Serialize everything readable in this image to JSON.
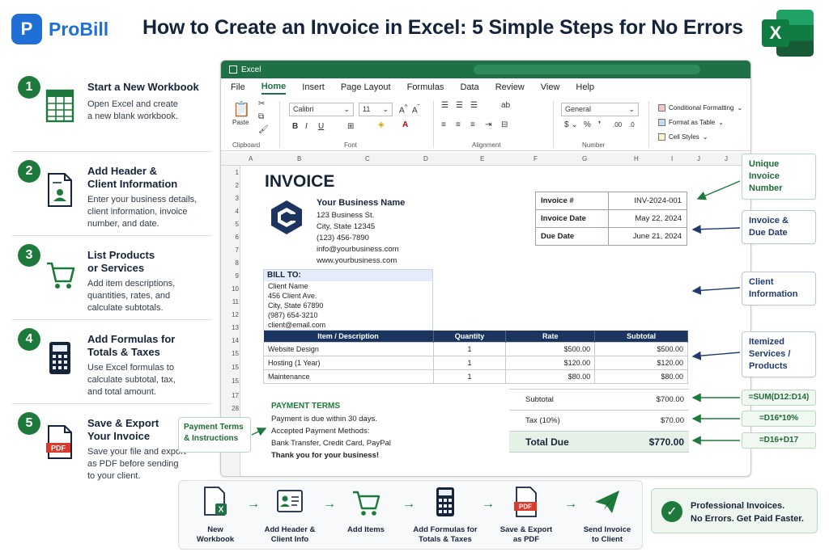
{
  "brand": {
    "logo_letter": "P",
    "name": "ProBill"
  },
  "title": "How to Create an Invoice in Excel: 5 Simple Steps for No Errors",
  "excel_logo_letter": "X",
  "steps": [
    {
      "num": "1",
      "title_lines": [
        "Start a New Workbook"
      ],
      "desc_lines": [
        "Open Excel and create",
        "a new blank workbook."
      ],
      "icon": "spreadsheet-icon"
    },
    {
      "num": "2",
      "title_lines": [
        "Add Header &",
        "Client Information"
      ],
      "desc_lines": [
        "Enter your business details,",
        "client information, invoice",
        "number, and date."
      ],
      "icon": "document-contact-icon"
    },
    {
      "num": "3",
      "title_lines": [
        "List Products",
        "or Services"
      ],
      "desc_lines": [
        "Add item descriptions,",
        "quantities, rates, and",
        "calculate subtotals."
      ],
      "icon": "shopping-cart-icon"
    },
    {
      "num": "4",
      "title_lines": [
        "Add Formulas for",
        "Totals & Taxes"
      ],
      "desc_lines": [
        "Use Excel formulas to",
        "calculate subtotal, tax,",
        "and total amount."
      ],
      "icon": "calculator-icon"
    },
    {
      "num": "5",
      "title_lines": [
        "Save & Export",
        "Your Invoice"
      ],
      "desc_lines": [
        "Save your file and export",
        "as PDF before sending",
        "to your client."
      ],
      "icon": "pdf-file-icon"
    }
  ],
  "excel": {
    "window_title": "Excel",
    "menu": [
      "File",
      "Home",
      "Insert",
      "Page Layout",
      "Formulas",
      "Data",
      "Review",
      "View",
      "Help"
    ],
    "active_menu": "Home",
    "ribbon": {
      "font_name": "Calibri",
      "font_size": "11",
      "number_format": "General",
      "paste_label": "Paste",
      "groups": [
        "Clipboard",
        "Font",
        "Alignment",
        "Number"
      ],
      "styles": [
        "Conditional Formatting",
        "Format as Table",
        "Cell Styles"
      ]
    },
    "columns": [
      "A",
      "B",
      "C",
      "D",
      "E",
      "F",
      "G",
      "H",
      "I",
      "J",
      "J"
    ],
    "rows": [
      "1",
      "2",
      "3",
      "4",
      "5",
      "6",
      "7",
      "8",
      "9",
      "10",
      "11",
      "12",
      "13",
      "14",
      "15",
      "15",
      "15",
      "17",
      "28",
      "19"
    ],
    "invoice": {
      "title": "INVOICE",
      "business": {
        "name": "Your Business Name",
        "lines": [
          "123 Business St.",
          "City, State 12345",
          "(123) 456-7890",
          "info@yourbusiness.com",
          "www.yourbusiness.com"
        ]
      },
      "meta": [
        {
          "label": "Invoice #",
          "value": "INV-2024-001"
        },
        {
          "label": "Invoice Date",
          "value": "May 22, 2024"
        },
        {
          "label": "Due Date",
          "value": "June 21, 2024"
        }
      ],
      "bill_to": {
        "heading": "BILL TO:",
        "lines": [
          "Client Name",
          "456 Client Ave.",
          "City, State 67890",
          "(987) 654-3210",
          "client@email.com"
        ]
      },
      "items_header": [
        "Item / Description",
        "Quantity",
        "Rate",
        "Subtotal"
      ],
      "items": [
        {
          "desc": "Website Design",
          "qty": "1",
          "rate": "$500.00",
          "subtotal": "$500.00"
        },
        {
          "desc": "Hosting (1 Year)",
          "qty": "1",
          "rate": "$120.00",
          "subtotal": "$120.00"
        },
        {
          "desc": "Maintenance",
          "qty": "1",
          "rate": "$80.00",
          "subtotal": "$80.00"
        }
      ],
      "payment": {
        "heading": "PAYMENT TERMS",
        "lines": [
          "Payment is due within 30 days.",
          "Accepted Payment Methods:",
          "Bank Transfer, Credit Card, PayPal",
          "Thank you for your business!"
        ]
      },
      "totals": [
        {
          "label": "Subtotal",
          "value": "$700.00"
        },
        {
          "label": "Tax (10%)",
          "value": "$70.00"
        },
        {
          "label": "Total Due",
          "value": "$770.00"
        }
      ]
    }
  },
  "callouts": [
    {
      "lines": [
        "Unique Invoice",
        "Number"
      ]
    },
    {
      "lines": [
        "Invoice &",
        "Due Date"
      ]
    },
    {
      "lines": [
        "Client",
        "Information"
      ]
    },
    {
      "lines": [
        "Itemized",
        "Services /",
        "Products"
      ]
    }
  ],
  "formulas": [
    "=SUM(D12:D14)",
    "=D16*10%",
    "=D16+D17"
  ],
  "payment_callout": [
    "Payment Terms",
    "& Instructions"
  ],
  "workflow": [
    {
      "lines": [
        "New",
        "Workbook"
      ]
    },
    {
      "lines": [
        "Add Header &",
        "Client Info"
      ]
    },
    {
      "lines": [
        "Add Items"
      ]
    },
    {
      "lines": [
        "Add Formulas for",
        "Totals & Taxes"
      ]
    },
    {
      "lines": [
        "Save & Export",
        "as PDF"
      ]
    },
    {
      "lines": [
        "Send Invoice",
        "to Client"
      ]
    }
  ],
  "badge": {
    "lines": [
      "Professional Invoices.",
      "No Errors. Get Paid Faster."
    ]
  },
  "colors": {
    "brand_blue": "#1f6fd6",
    "excel_green": "#1e7145",
    "step_green": "#1d7a3c",
    "navy": "#1b3560"
  }
}
